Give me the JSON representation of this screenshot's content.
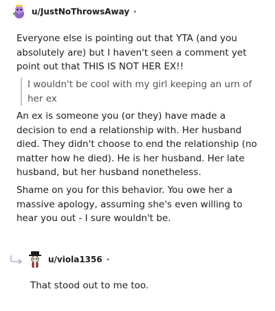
{
  "comment": {
    "username": "u/JustNoThrowsAway",
    "separator": "•",
    "paragraph_1": "Everyone else is pointing out that YTA (and you absolutely are) but I haven't seen a comment yet point out that THIS IS NOT HER EX!!",
    "quote": "I wouldn't be cool with my girl keeping an urn of her ex",
    "paragraph_2": "An ex is someone you (or they) have made a decision to end a relationship with. Her husband died. They didn't choose to end the relationship (no matter how he died). He is her husband. Her late husband, but her husband nonetheless.",
    "paragraph_3": "Shame on you for this behavior. You owe her a massive apology, assuming she's even willing to hear you out - I sure wouldn't be."
  },
  "reply": {
    "username": "u/viola1356",
    "separator": "•",
    "text": "That stood out to me too."
  },
  "colors": {
    "text": "#1c1c1c",
    "meta": "#7c7c7c",
    "quote_bar": "#c4c4c4",
    "reply_arrow": "#a8b4c8"
  },
  "icons": {
    "avatar_1": "purple-snoo-avatar",
    "avatar_2": "snoo-avatar-black-hat",
    "reply_arrow": "reply-arrow-icon"
  }
}
